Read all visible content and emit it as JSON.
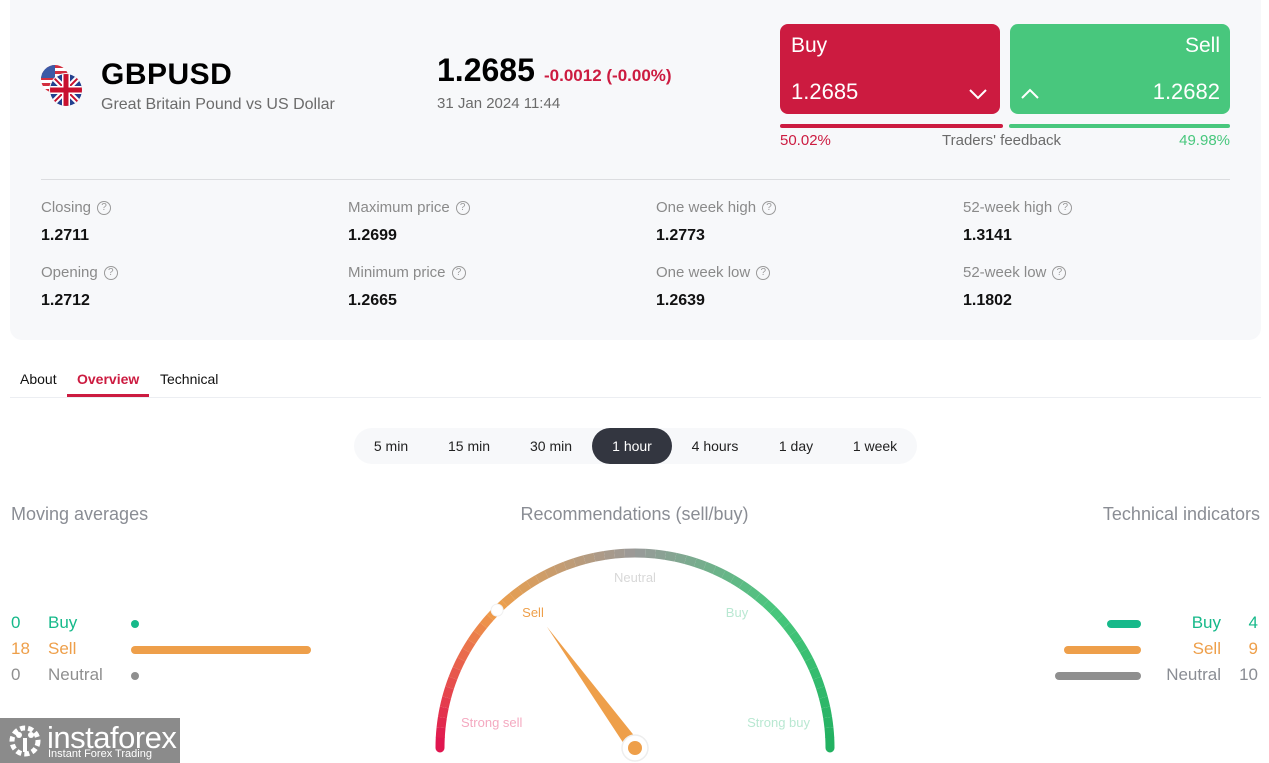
{
  "instrument": {
    "symbol": "GBPUSD",
    "description": "Great Britain Pound vs US Dollar",
    "flag_icon": "gb-us-flags-icon",
    "price": "1.2685",
    "change": "-0.0012 (-0.00%)",
    "timestamp": "31 Jan 2024 11:44"
  },
  "trade": {
    "buy": {
      "label": "Buy",
      "value": "1.2685",
      "icon": "chevron-down-icon",
      "color": "#cc1b40"
    },
    "sell": {
      "label": "Sell",
      "value": "1.2682",
      "icon": "chevron-up-icon",
      "color": "#48c77d"
    }
  },
  "feedback": {
    "title": "Traders' feedback",
    "buy_pct": "50.02%",
    "sell_pct": "49.98%",
    "buy_fraction": 0.5002,
    "sell_fraction": 0.4998
  },
  "stats": [
    {
      "label": "Closing",
      "value": "1.2711"
    },
    {
      "label": "Opening",
      "value": "1.2712"
    },
    {
      "label": "Maximum price",
      "value": "1.2699"
    },
    {
      "label": "Minimum price",
      "value": "1.2665"
    },
    {
      "label": "One week high",
      "value": "1.2773"
    },
    {
      "label": "One week low",
      "value": "1.2639"
    },
    {
      "label": "52-week high",
      "value": "1.3141"
    },
    {
      "label": "52-week low",
      "value": "1.1802"
    }
  ],
  "help_glyph": "?",
  "tabs": [
    {
      "label": "About",
      "active": false
    },
    {
      "label": "Overview",
      "active": true
    },
    {
      "label": "Technical",
      "active": false
    }
  ],
  "periods": [
    {
      "label": "5 min",
      "active": false
    },
    {
      "label": "15 min",
      "active": false
    },
    {
      "label": "30 min",
      "active": false
    },
    {
      "label": "1 hour",
      "active": true
    },
    {
      "label": "4 hours",
      "active": false
    },
    {
      "label": "1 day",
      "active": false
    },
    {
      "label": "1 week",
      "active": false
    }
  ],
  "moving_averages": {
    "title": "Moving averages",
    "rows": [
      {
        "count": "0",
        "label": "Buy",
        "value": 0,
        "color": "#16b98a"
      },
      {
        "count": "18",
        "label": "Sell",
        "value": 18,
        "color": "#ee9f4a"
      },
      {
        "count": "0",
        "label": "Neutral",
        "value": 0,
        "color": "#8f8f8f"
      }
    ]
  },
  "recommendations": {
    "title": "Recommendations (sell/buy)",
    "labels": {
      "strong_sell": "Strong sell",
      "sell": "Sell",
      "neutral": "Neutral",
      "buy": "Buy",
      "strong_buy": "Strong buy"
    },
    "current": "Sell",
    "needle_position": 0.3,
    "marker_position": 0.25,
    "colors": {
      "strong_sell": "#e0114f",
      "sell": "#ee9f4a",
      "neutral": "#999999",
      "buy": "#48c77d",
      "strong_buy": "#22b060"
    }
  },
  "technical_indicators": {
    "title": "Technical indicators",
    "rows": [
      {
        "count": "4",
        "label": "Buy",
        "value": 4,
        "color": "#16b98a"
      },
      {
        "count": "9",
        "label": "Sell",
        "value": 9,
        "color": "#ee9f4a"
      },
      {
        "count": "10",
        "label": "Neutral",
        "value": 10,
        "color": "#8f8f8f"
      }
    ]
  },
  "logo": {
    "brand": "instaforex",
    "tagline": "Instant Forex Trading"
  }
}
